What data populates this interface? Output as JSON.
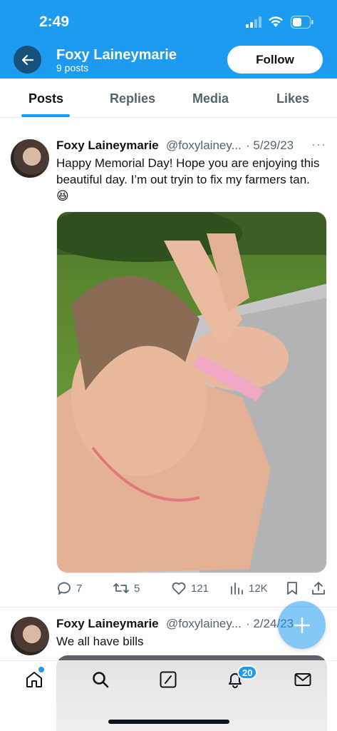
{
  "status_bar": {
    "time": "2:49"
  },
  "header": {
    "profile_name": "Foxy Laineymarie",
    "post_count": "9 posts",
    "follow_label": "Follow"
  },
  "tabs": [
    {
      "label": "Posts",
      "active": true
    },
    {
      "label": "Replies",
      "active": false
    },
    {
      "label": "Media",
      "active": false
    },
    {
      "label": "Likes",
      "active": false
    }
  ],
  "posts": [
    {
      "name": "Foxy Laineymarie",
      "handle": "@foxylainey...",
      "date": "· 5/29/23",
      "text": "Happy Memorial Day! Hope you are enjoying this beautiful day. I’m out tryin to fix my farmers tan. 😆",
      "replies": "7",
      "reposts": "5",
      "likes": "121",
      "views": "12K"
    },
    {
      "name": "Foxy Laineymarie",
      "handle": "@foxylainey...",
      "date": "· 2/24/23",
      "text": "We all have bills"
    }
  ],
  "bottom_nav": {
    "notifications_badge": "20"
  },
  "colors": {
    "accent": "#1d9bf0",
    "text": "#0f1419",
    "muted": "#536471"
  }
}
